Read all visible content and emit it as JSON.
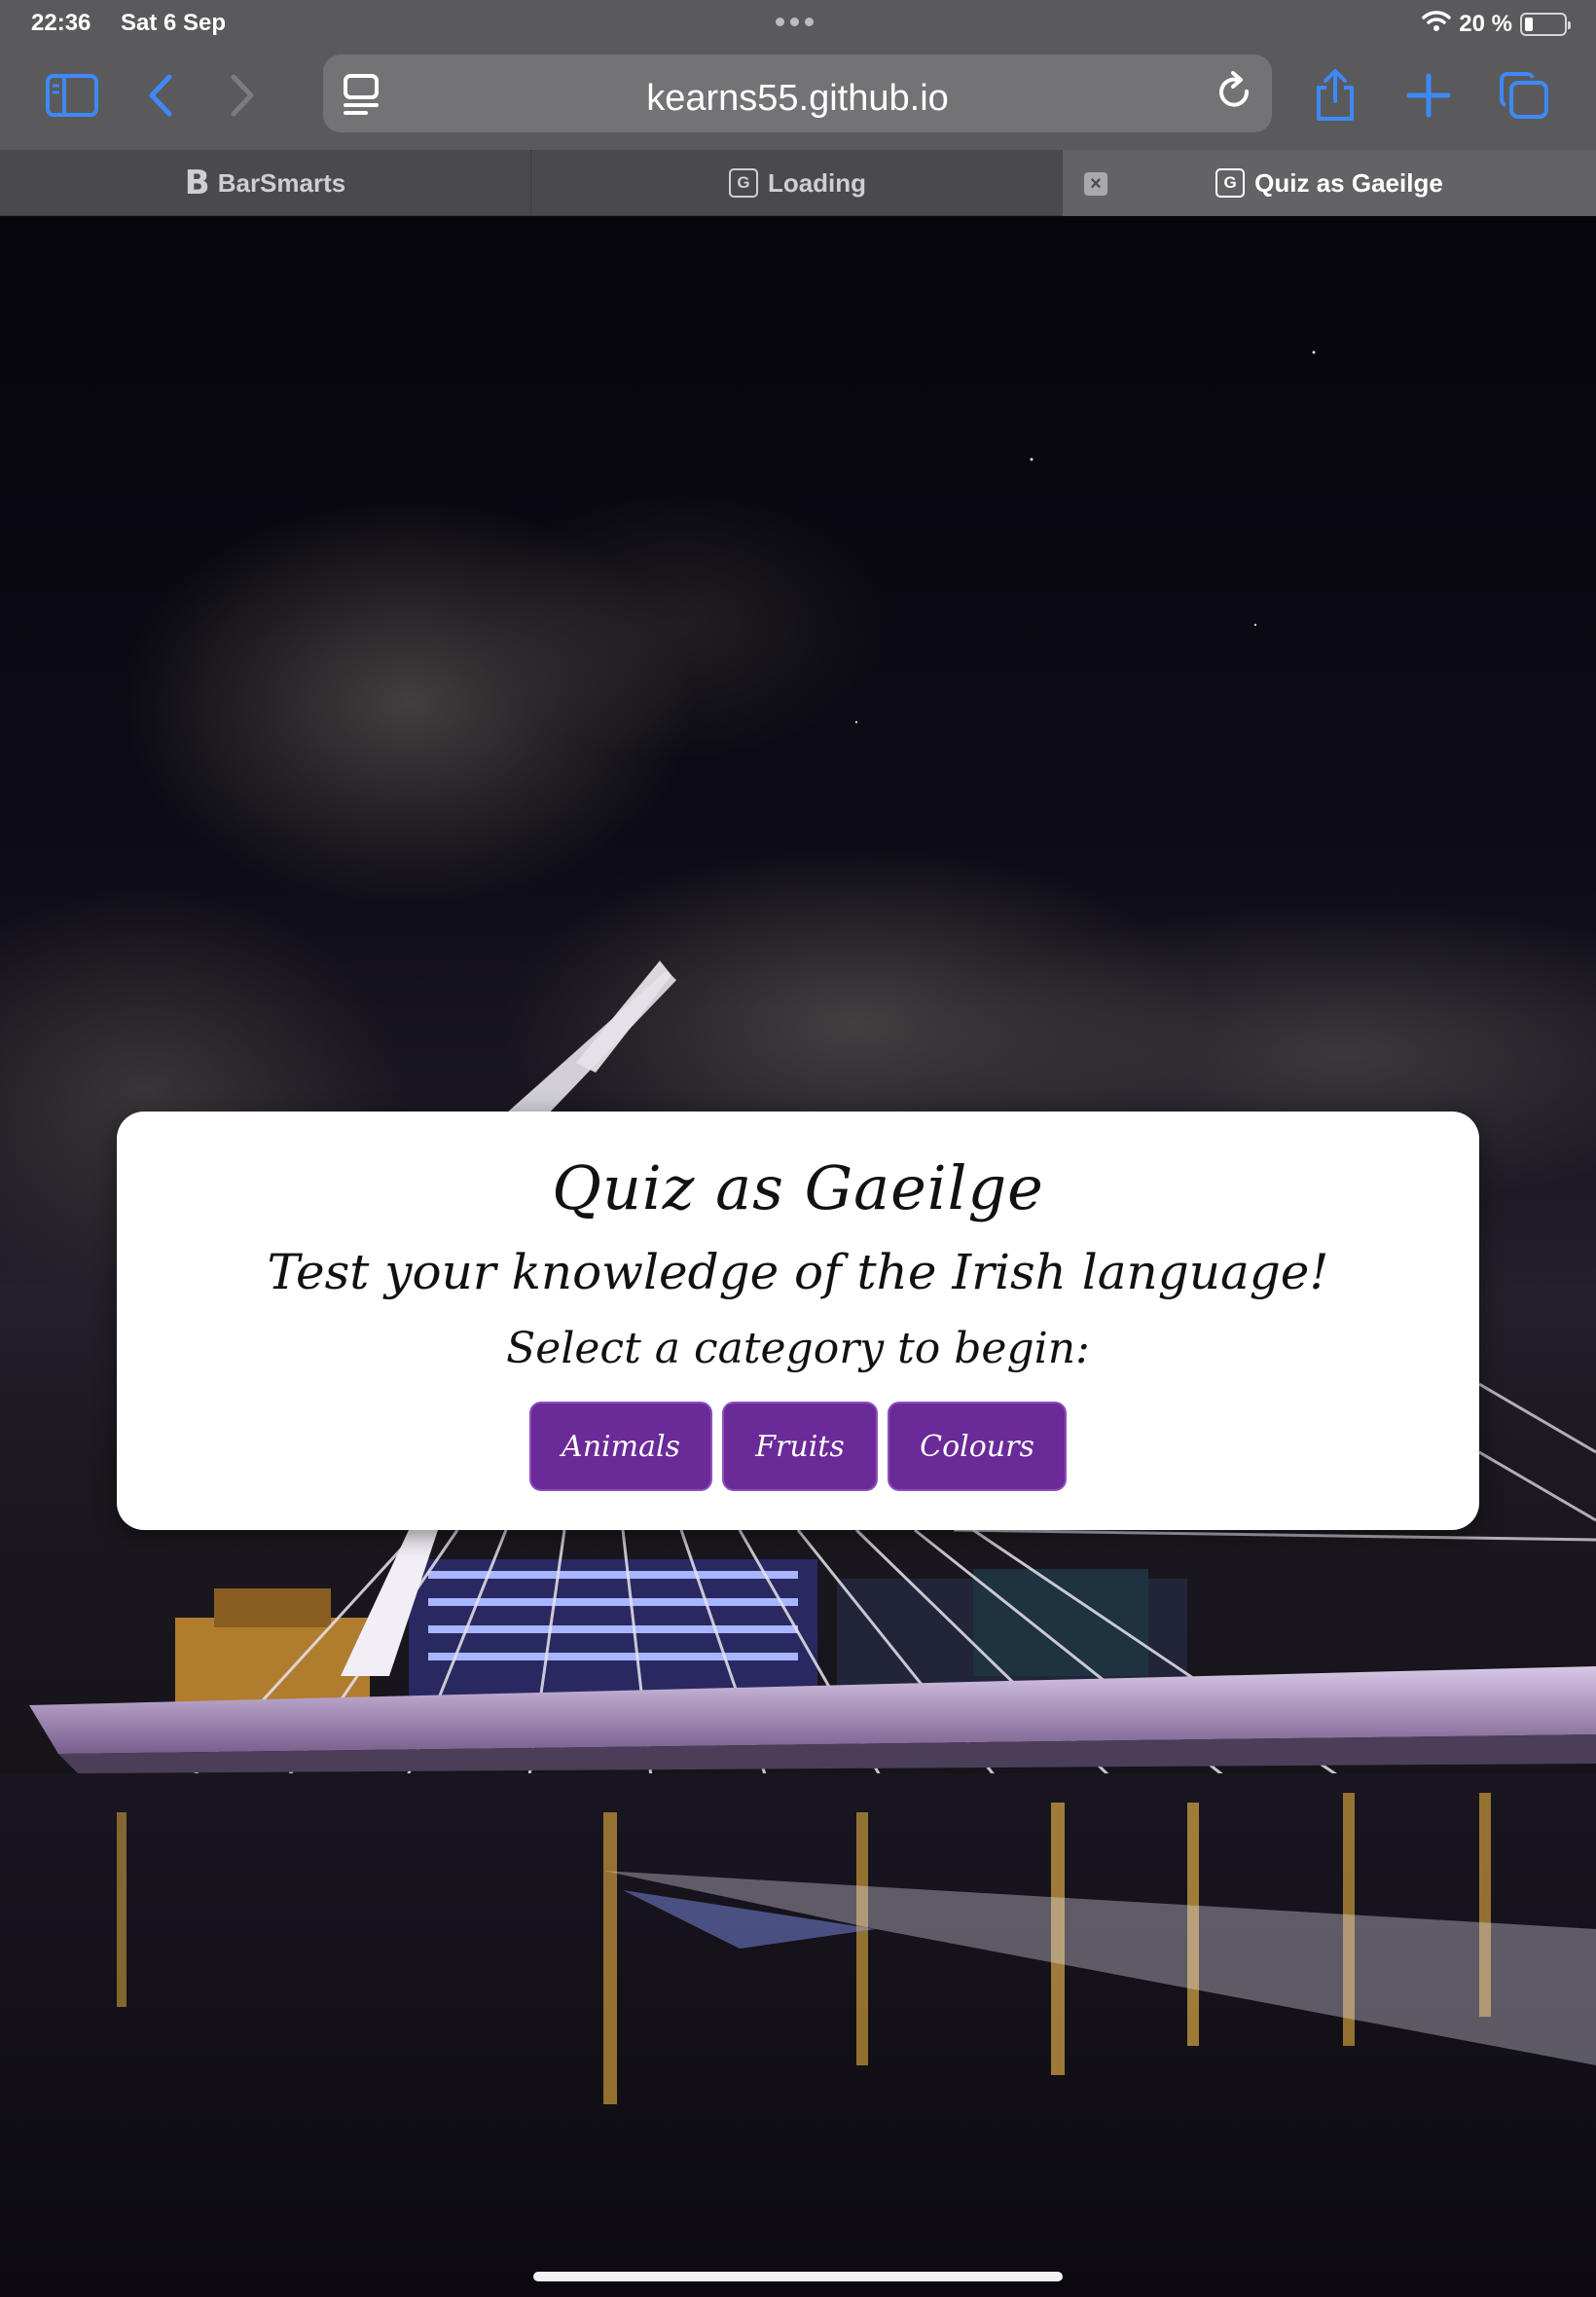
{
  "status_bar": {
    "time": "22:36",
    "date": "Sat 6 Sep",
    "battery_text": "20 %",
    "battery_level": 0.2
  },
  "toolbar": {
    "url": "kearns55.github.io",
    "icons": [
      "sidebar-icon",
      "back-icon",
      "forward-icon",
      "reader-icon",
      "reload-icon",
      "share-icon",
      "new-tab-icon",
      "tabs-overview-icon"
    ],
    "accent": "#3d8af7"
  },
  "tabs": [
    {
      "label": "BarSmarts",
      "favicon": "B",
      "active": false
    },
    {
      "label": "Loading",
      "favicon": "G",
      "active": false
    },
    {
      "label": "Quiz as Gaeilge",
      "favicon": "G",
      "active": true
    }
  ],
  "quiz": {
    "title": "Quiz as Gaeilge",
    "subtitle": "Test your knowledge of the Irish language!",
    "prompt": "Select a category to begin:",
    "categories": [
      "Animals",
      "Fruits",
      "Colours"
    ],
    "button_color": "#6a2a98"
  }
}
